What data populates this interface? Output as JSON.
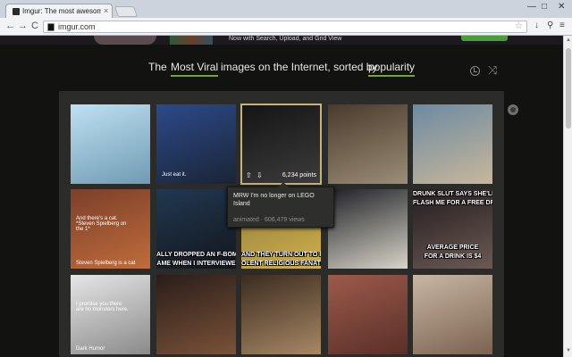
{
  "browser": {
    "tab_title": "Imgur: The most awesom",
    "tab_close": "×",
    "url": "imgur.com",
    "nav": {
      "back": "←",
      "forward": "→",
      "reload": "C"
    },
    "window": {
      "minimize": "—",
      "maximize": "□",
      "close": "✕"
    },
    "toolbar_icons": {
      "download": "↓",
      "search": "⚲",
      "menu": "≡"
    },
    "star": "☆"
  },
  "banner": {
    "promo_text": "Now with Search, Upload, and Grid View"
  },
  "headline": {
    "prefix": "The",
    "sort_mode": "Most Viral",
    "middle": "images on the Internet, sorted by",
    "sort_by": "popularity"
  },
  "controls": {
    "shuffle_glyph": "⤨"
  },
  "thumbnails": [
    {
      "colors": [
        "#bfe0f2",
        "#6f9bb3"
      ]
    },
    {
      "colors": [
        "#2c4a8a",
        "#1a2436"
      ],
      "caption": "Just eat it."
    },
    {
      "colors": [
        "#141414",
        "#3c3c3c"
      ],
      "points": "6,234 points",
      "up": "⇧",
      "down": "⇩"
    },
    {
      "colors": [
        "#4a3a2c",
        "#9c8d77"
      ]
    },
    {
      "colors": [
        "#6d8aa2",
        "#c7b79b"
      ]
    },
    {
      "colors": [
        "#7b3f2a",
        "#c06c3b"
      ],
      "caption": "And there's a cat. *Steven Spielberg on the 1*",
      "caption2": "Steven Spielberg is a cat"
    },
    {
      "colors": [
        "#203852",
        "#13161c"
      ],
      "meme": "ALLY DROPPED AN F-BOM",
      "meme2": "AME WHEN I INTERVIEWE"
    },
    {
      "colors": [
        "#8c7a3f",
        "#d2b14a"
      ],
      "meme": "AND THEY TURN OUT TO BE",
      "meme2": "OLENT RELIGIOUS FANATIC"
    },
    {
      "colors": [
        "#1e2126",
        "#d9d4c8"
      ]
    },
    {
      "colors": [
        "#251c1f",
        "#6a5a52"
      ],
      "meme": "DRUNK SLUT SAYS SHE'LL",
      "meme2": "FLASH ME FOR A FREE DRINK",
      "meme3": "AVERAGE PRICE",
      "meme4": "FOR A DRINK IS $4"
    },
    {
      "colors": [
        "#e6e6e6",
        "#8a8a8a"
      ],
      "caption": "I promise you there are no monsters here.",
      "caption2": "Dark Humor"
    },
    {
      "colors": [
        "#2a1d1a",
        "#7a5238"
      ]
    },
    {
      "colors": [
        "#3b2b1f",
        "#a78865"
      ]
    },
    {
      "colors": [
        "#9c5a4a",
        "#5a2f28"
      ]
    },
    {
      "colors": [
        "#c8b6a4",
        "#7b6250"
      ]
    }
  ],
  "tooltip": {
    "title": "MRW I'm no longer on LEGO Island",
    "meta": "animated · 606,479 views"
  }
}
